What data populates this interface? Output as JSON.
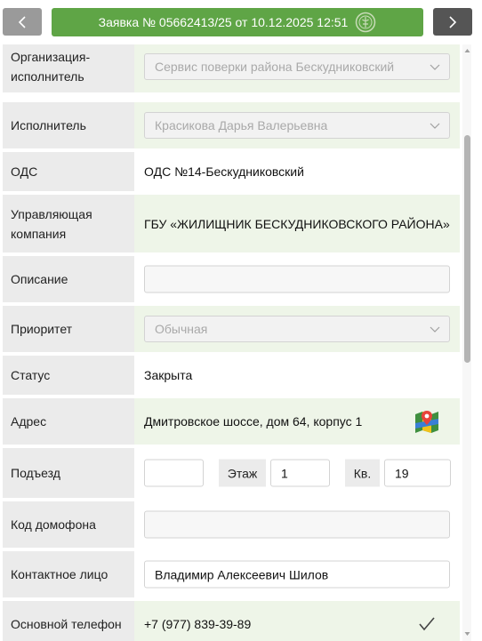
{
  "header": {
    "title": "Заявка № 05662413/25 от 10.12.2025 12:51",
    "prev_icon": "chevron-left-icon",
    "next_icon": "chevron-right-icon",
    "seal_icon": "emblem-icon"
  },
  "form": {
    "org_label": "Организация-исполнитель",
    "org_value": "Сервис поверки района Бескудниковский",
    "executor_label": "Исполнитель",
    "executor_value": "Красикова Дарья Валерьевна",
    "ods_label": "ОДС",
    "ods_value": "ОДС №14-Бескудниковский",
    "company_label": "Управляющая компания",
    "company_value": "ГБУ «ЖИЛИЩНИК БЕСКУДНИКОВСКОГО РАЙОНА»",
    "description_label": "Описание",
    "description_value": "",
    "priority_label": "Приоритет",
    "priority_value": "Обычная",
    "status_label": "Статус",
    "status_value": "Закрыта",
    "address_label": "Адрес",
    "address_value": "Дмитровское шоссе, дом 64, корпус 1",
    "entrance_label": "Подъезд",
    "entrance_value": "",
    "floor_label": "Этаж",
    "floor_value": "1",
    "apt_label": "Кв.",
    "apt_value": "19",
    "intercom_label": "Код домофона",
    "intercom_value": "",
    "contact_label": "Контактное лицо",
    "contact_value": "Владимир Алексеевич Шилов",
    "phone_label": "Основной телефон",
    "phone_value": "+7 (977) 839-39-89"
  },
  "colors": {
    "title_bar": "#5fa546",
    "label_bg": "#ebebeb",
    "value_green_bg": "#eef5e8"
  }
}
